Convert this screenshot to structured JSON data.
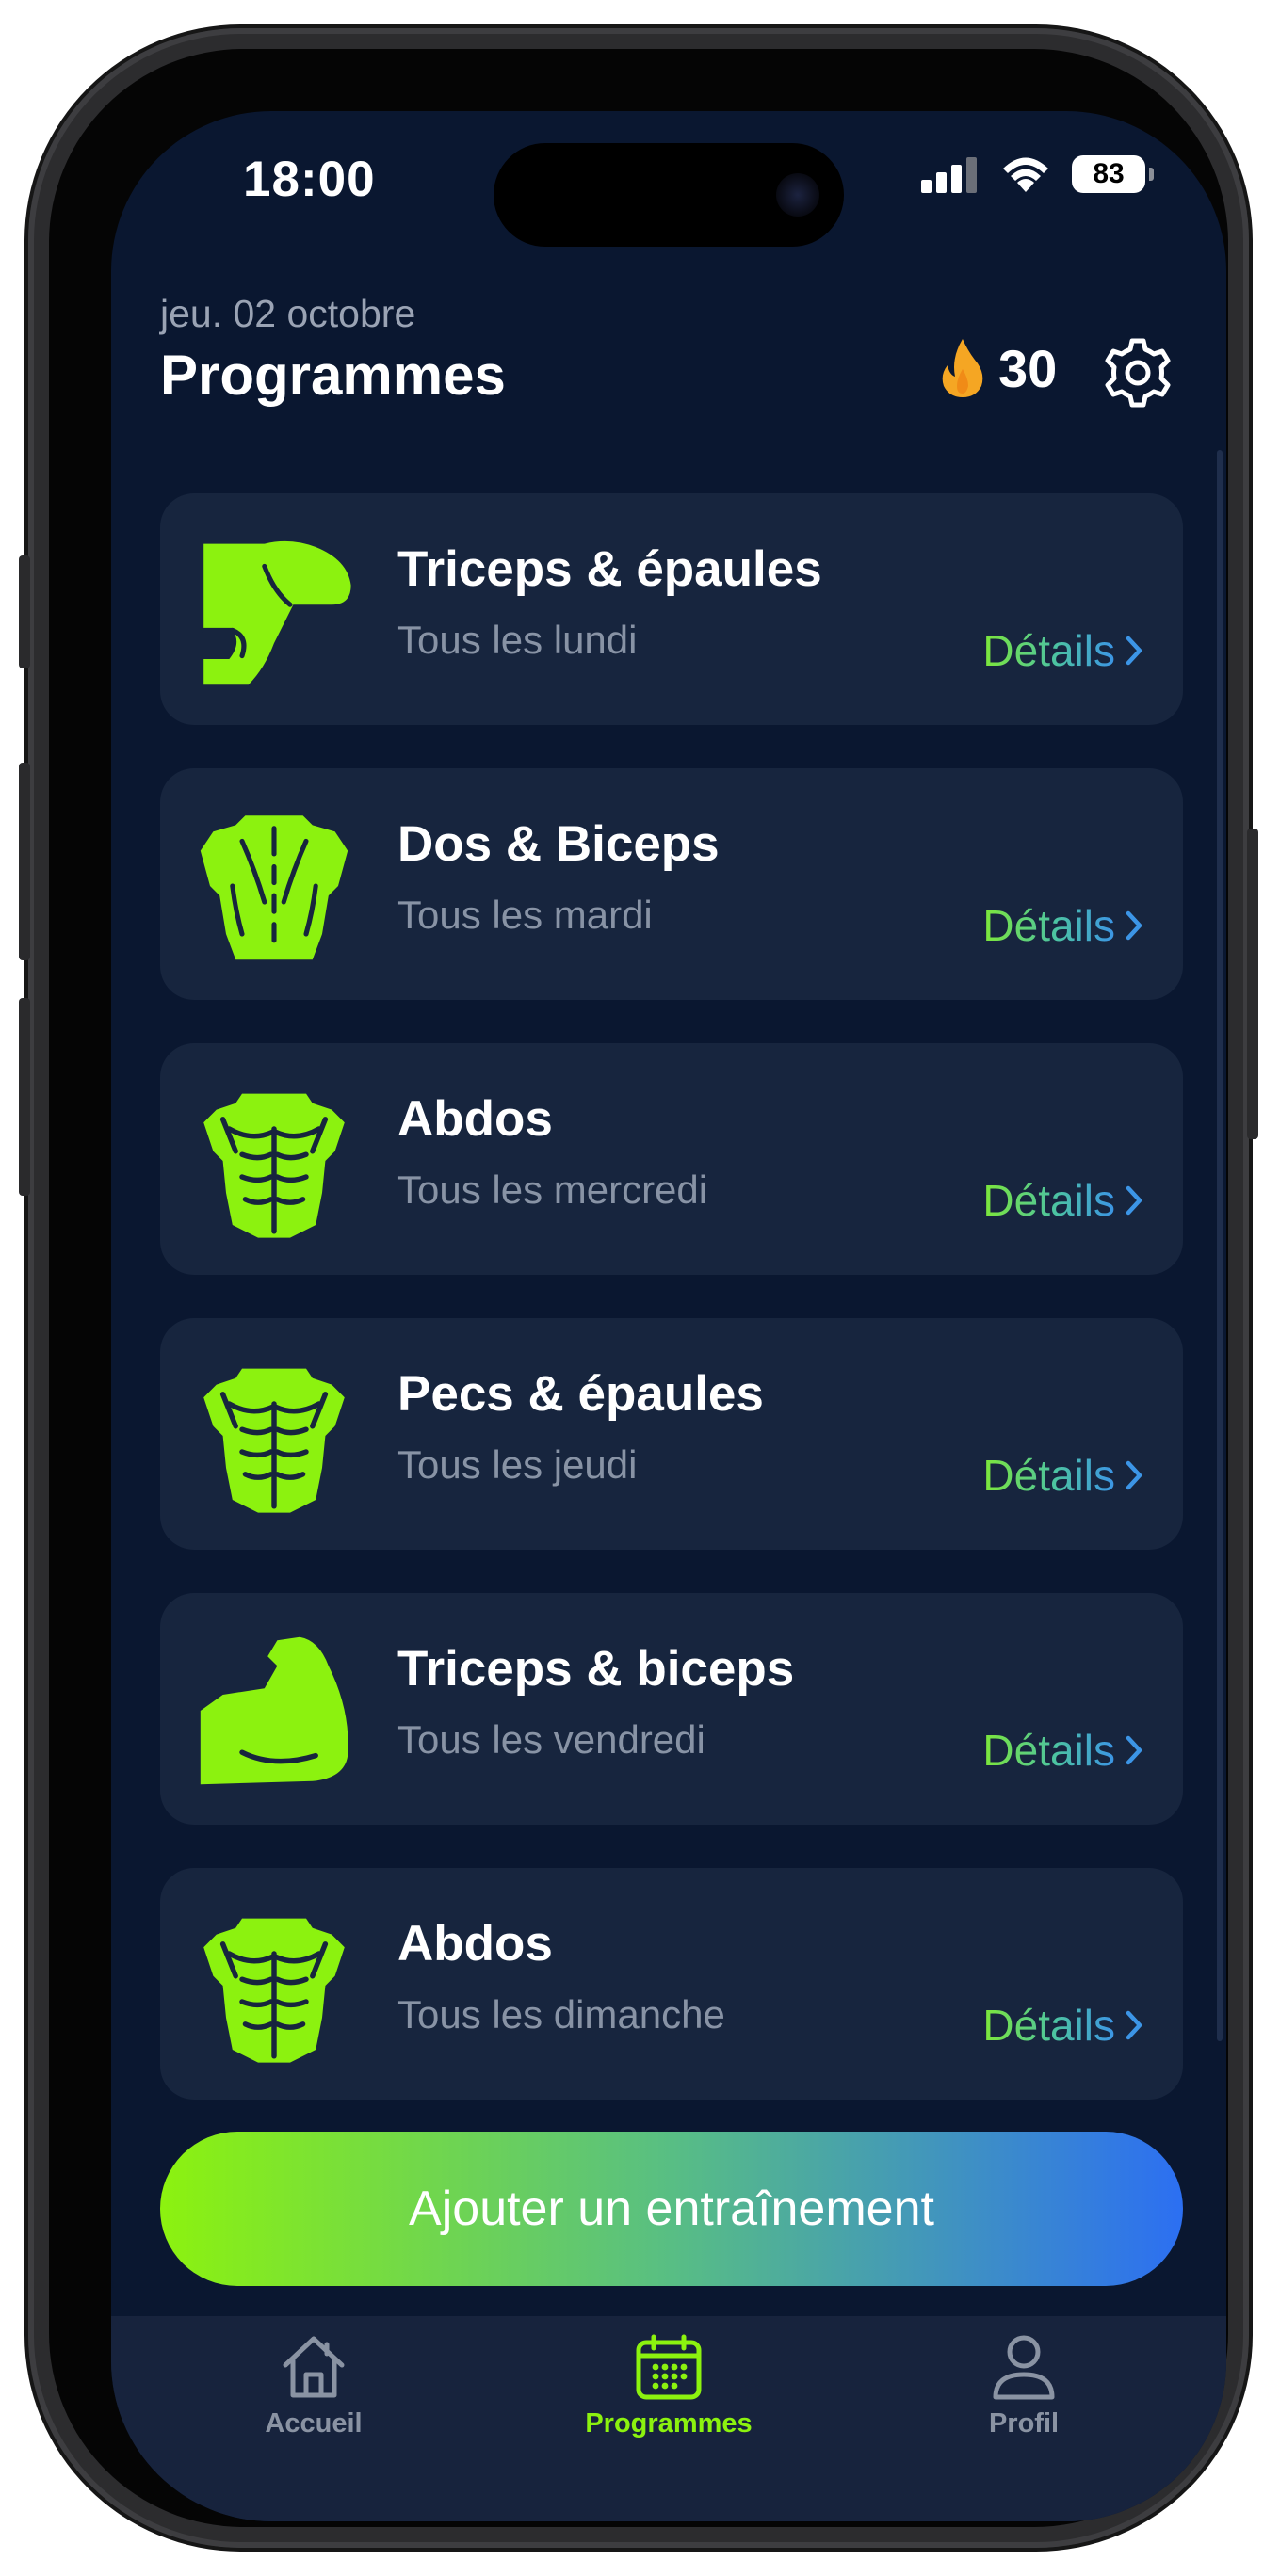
{
  "status_bar": {
    "time": "18:00",
    "battery": "83"
  },
  "header": {
    "date": "jeu. 02 octobre",
    "title": "Programmes",
    "streak": "30"
  },
  "programs": [
    {
      "title": "Triceps & épaules",
      "subtitle": "Tous les lundi",
      "details": "Détails",
      "icon": "shoulder-icon"
    },
    {
      "title": "Dos & Biceps",
      "subtitle": "Tous les mardi",
      "details": "Détails",
      "icon": "back-torso-icon"
    },
    {
      "title": "Abdos",
      "subtitle": "Tous les mercredi",
      "details": "Détails",
      "icon": "abs-torso-icon"
    },
    {
      "title": "Pecs & épaules",
      "subtitle": "Tous les jeudi",
      "details": "Détails",
      "icon": "abs-torso-icon"
    },
    {
      "title": "Triceps & biceps",
      "subtitle": "Tous les vendredi",
      "details": "Détails",
      "icon": "flexed-arm-icon"
    },
    {
      "title": "Abdos",
      "subtitle": "Tous les dimanche",
      "details": "Détails",
      "icon": "abs-torso-icon"
    }
  ],
  "add_button": {
    "label": "Ajouter un entraînement"
  },
  "tabs": [
    {
      "label": "Accueil",
      "icon": "home-icon",
      "active": false
    },
    {
      "label": "Programmes",
      "icon": "calendar-icon",
      "active": true
    },
    {
      "label": "Profil",
      "icon": "person-icon",
      "active": false
    }
  ],
  "colors": {
    "background": "#0a1730",
    "card": "#17253e",
    "accent_green": "#8cf20f",
    "accent_blue": "#2c6ff2",
    "flame": "#f5a623",
    "inactive_tab": "#8a93a3"
  }
}
